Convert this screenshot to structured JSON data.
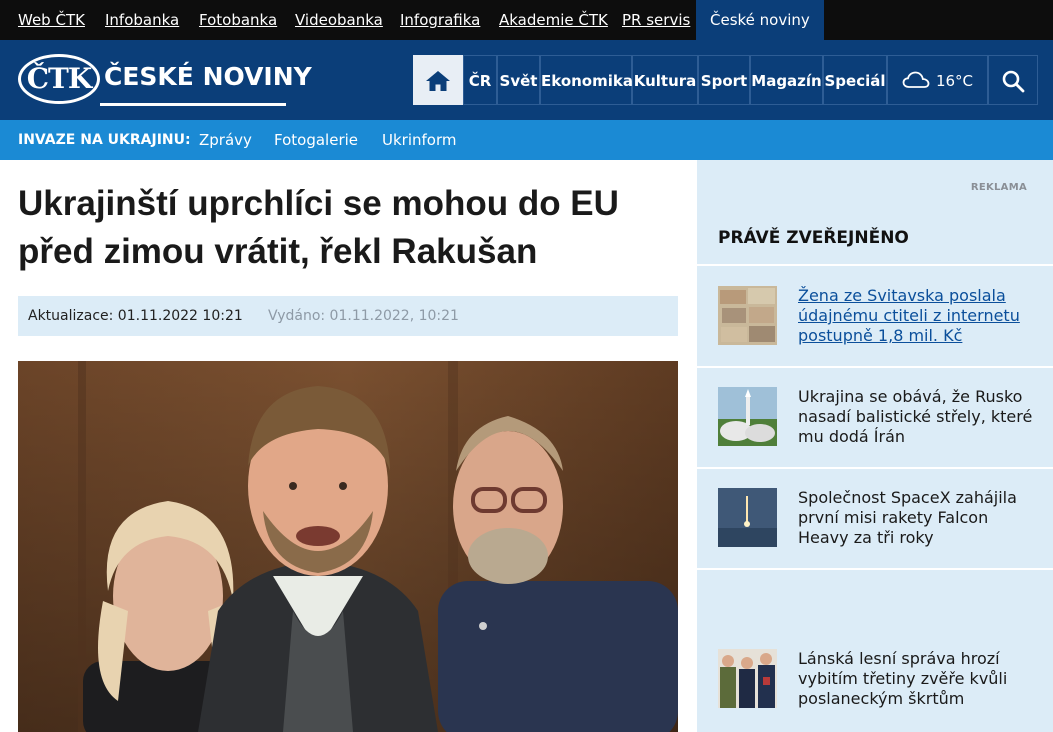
{
  "topbar": {
    "links": [
      "Web ČTK",
      "Infobanka",
      "Fotobanka",
      "Videobanka",
      "Infografika",
      "Akademie ČTK",
      "PR servis"
    ],
    "active": "České noviny"
  },
  "header": {
    "logo_mark": "ČTK",
    "logo_text": "ČESKÉ NOVINY",
    "nav": [
      "ČR",
      "Svět",
      "Ekonomika",
      "Kultura",
      "Sport",
      "Magazín",
      "Speciál"
    ],
    "temperature": "16°C",
    "accent_color": "#0b3e79"
  },
  "subbar": {
    "lead": "INVAZE NA UKRAJINU:",
    "links": [
      "Zprávy",
      "Fotogalerie",
      "Ukrinform"
    ],
    "color": "#1b8ad4"
  },
  "article": {
    "title": "Ukrajinští uprchlíci se mohou do EU před zimou vrátit, řekl Rakušan",
    "updated": "Aktualizace: 01.11.2022 10:21",
    "published": "Vydáno: 01.11.2022, 10:21"
  },
  "sidebar": {
    "ad_label": "REKLAMA",
    "title": "PRÁVĚ ZVEŘEJNĚNO",
    "items": [
      {
        "text": "Žena ze Svitavska poslala údajnému ctiteli z internetu postupně 1,8 mil. Kč",
        "thumb": "banknotes"
      },
      {
        "text": "Ukrajina se obává, že Rusko nasadí balistické střely, které mu dodá Írán",
        "thumb": "missile-launch"
      },
      {
        "text": "Společnost SpaceX zahájila první misi rakety Falcon Heavy za tři roky",
        "thumb": "rocket-night"
      },
      {
        "text": "Lánská lesní správa hrozí vybitím třetiny zvěře kvůli poslaneckým škrtům",
        "thumb": "people"
      }
    ]
  }
}
